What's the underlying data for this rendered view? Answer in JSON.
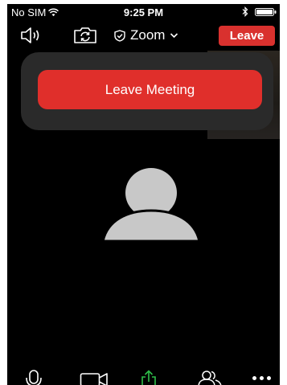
{
  "status_bar": {
    "carrier": "No SIM",
    "time": "9:25 PM",
    "icons": [
      "wifi-icon",
      "bluetooth-icon",
      "battery-icon"
    ]
  },
  "toolbar": {
    "speaker_icon": "speaker-icon",
    "camera_switch_icon": "camera-switch-icon",
    "meeting_menu_label": "Zoom",
    "meeting_menu_icons": [
      "shield-check-icon",
      "chevron-down-icon"
    ],
    "leave_label": "Leave",
    "leave_color": "#d9312e"
  },
  "leave_popup": {
    "leave_meeting_label": "Leave Meeting",
    "button_color": "#e02f2b",
    "panel_color": "#2a2a2a"
  },
  "participant": {
    "avatar_icon": "person-placeholder-icon",
    "avatar_color": "#c8c8c8"
  },
  "bottom_bar": {
    "items": [
      {
        "name": "microphone-icon"
      },
      {
        "name": "video-camera-icon"
      },
      {
        "name": "share-icon",
        "color": "#2fbf4a"
      },
      {
        "name": "participants-icon"
      },
      {
        "name": "more-icon"
      }
    ]
  }
}
